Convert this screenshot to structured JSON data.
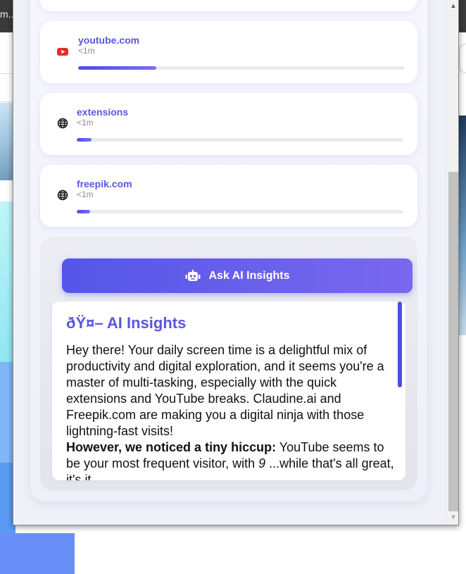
{
  "background": {
    "tab_text": "m.."
  },
  "sites": [
    {
      "name": "youtube.com",
      "time": "<1m",
      "icon": "youtube-icon",
      "progress": 0.24
    },
    {
      "name": "extensions",
      "time": "<1m",
      "icon": "globe-icon",
      "progress": 0.045
    },
    {
      "name": "freepik.com",
      "time": "<1m",
      "icon": "globe-icon",
      "progress": 0.04
    }
  ],
  "ai": {
    "button_label": "Ask AI Insights",
    "button_icon": "robot-icon",
    "title": "ðŸ¤– AI Insights",
    "paragraph1": "Hey there! Your daily screen time is a delightful mix of productivity and digital exploration, and it seems you're a master of multi-tasking, especially with the quick extensions and YouTube breaks. Claudine.ai and Freepik.com are making you a digital ninja with those lightning-fast visits!",
    "hiccup_label": "However, we noticed a tiny hiccup:",
    "hiccup_text": " YouTube seems to be your most frequent visitor, with ",
    "hiccup_number": "9",
    "hiccup_tail": " ...while that's all great, it's it..."
  },
  "colors": {
    "accent": "#5b55e0",
    "gradient_start": "#5456e8",
    "gradient_end": "#7a68ee"
  }
}
